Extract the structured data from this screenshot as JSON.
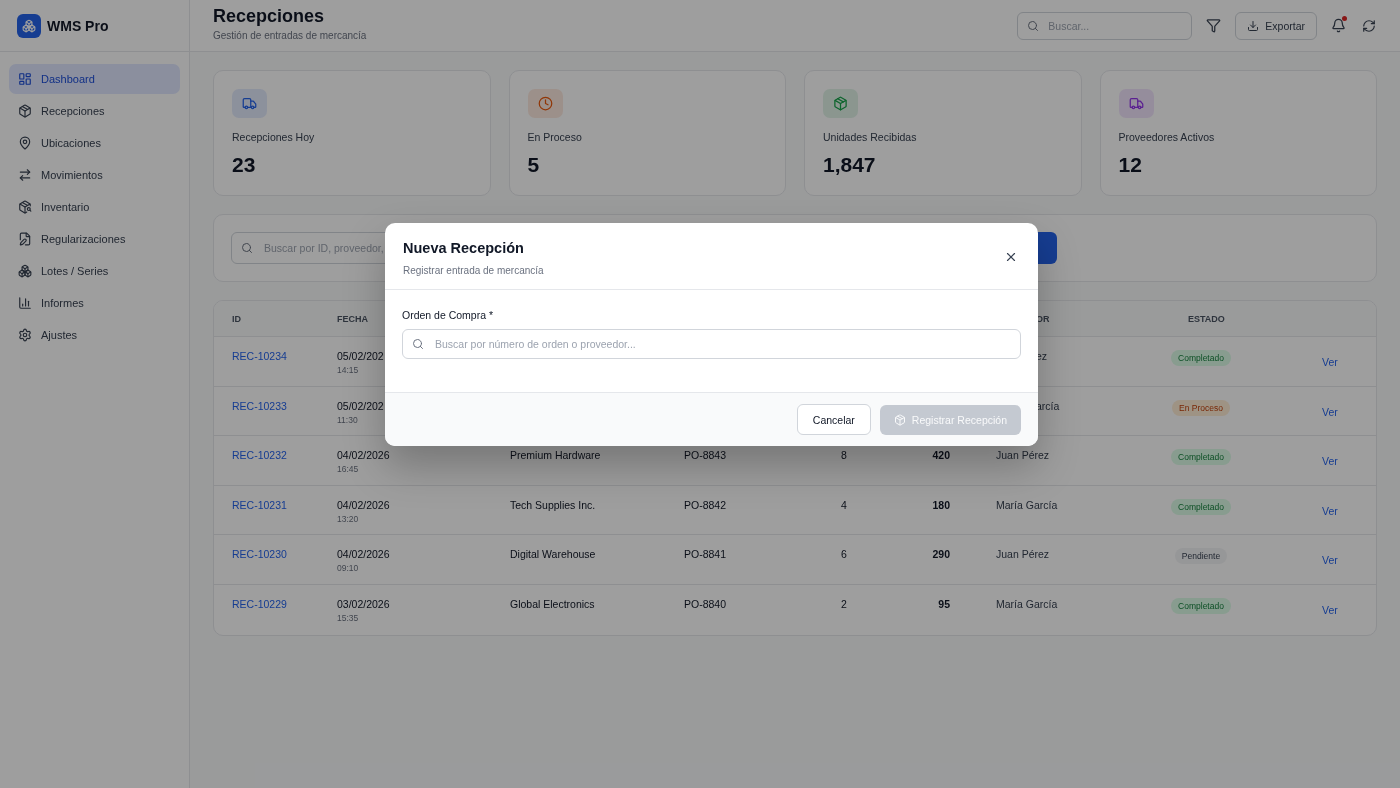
{
  "sidebar": {
    "brand": "WMS Pro",
    "items": [
      {
        "label": "Dashboard",
        "selected": true
      },
      {
        "label": "Recepciones",
        "selected": false
      },
      {
        "label": "Ubicaciones",
        "selected": false
      },
      {
        "label": "Movimientos",
        "selected": false
      },
      {
        "label": "Inventario",
        "selected": false
      },
      {
        "label": "Regularizaciones",
        "selected": false
      },
      {
        "label": "Lotes / Series",
        "selected": false
      },
      {
        "label": "Informes",
        "selected": false
      },
      {
        "label": "Ajustes",
        "selected": false
      }
    ]
  },
  "header": {
    "title": "Recepciones",
    "subtitle": "Gestión de entradas de mercancía",
    "search": {
      "placeholder": "Buscar..."
    },
    "export_button": "Exportar",
    "notifications": {
      "unread": true
    }
  },
  "stats": [
    {
      "label": "Recepciones Hoy",
      "value": "23"
    },
    {
      "label": "En Proceso",
      "value": "5"
    },
    {
      "label": "Unidades Recibidas",
      "value": "1,847"
    },
    {
      "label": "Proveedores Activos",
      "value": "12"
    }
  ],
  "filters": {
    "search": {
      "placeholder": "Buscar por ID, proveedor,"
    }
  },
  "table": {
    "columns": [
      "ID",
      "FECHA",
      "OR",
      "ESTADO"
    ],
    "rows": [
      {
        "id": "REC-10234",
        "date": "05/02/202",
        "time": "14:15",
        "user": "ez",
        "user_cut": true,
        "status": "Completado",
        "kind": "completed",
        "action": "Ver"
      },
      {
        "id": "REC-10233",
        "date": "05/02/202",
        "time": "11:30",
        "user": "arcía",
        "user_cut": true,
        "status": "En Proceso",
        "kind": "in_progress",
        "action": "Ver"
      },
      {
        "id": "REC-10232",
        "date": "04/02/2026",
        "time": "16:45",
        "supplier": "Premium Hardware",
        "order": "PO-8843",
        "items": "8",
        "units": "420",
        "user": "Juan Pérez",
        "user_cut": false,
        "status": "Completado",
        "kind": "completed",
        "action": "Ver"
      },
      {
        "id": "REC-10231",
        "date": "04/02/2026",
        "time": "13:20",
        "supplier": "Tech Supplies Inc.",
        "order": "PO-8842",
        "items": "4",
        "units": "180",
        "user": "María García",
        "user_cut": false,
        "status": "Completado",
        "kind": "completed",
        "action": "Ver"
      },
      {
        "id": "REC-10230",
        "date": "04/02/2026",
        "time": "09:10",
        "supplier": "Digital Warehouse",
        "order": "PO-8841",
        "items": "6",
        "units": "290",
        "user": "Juan Pérez",
        "user_cut": false,
        "status": "Pendiente",
        "kind": "pending",
        "action": "Ver"
      },
      {
        "id": "REC-10229",
        "date": "03/02/2026",
        "time": "15:35",
        "supplier": "Global Electronics",
        "order": "PO-8840",
        "items": "2",
        "units": "95",
        "user": "María García",
        "user_cut": false,
        "status": "Completado",
        "kind": "completed",
        "action": "Ver"
      }
    ]
  },
  "modal": {
    "title": "Nueva Recepción",
    "subtitle": "Registrar entrada de mercancía",
    "field_label": "Orden de Compra *",
    "field_placeholder": "Buscar por número de orden o proveedor...",
    "cancel": "Cancelar",
    "submit": {
      "label": "Registrar Recepción",
      "disabled": true
    }
  }
}
